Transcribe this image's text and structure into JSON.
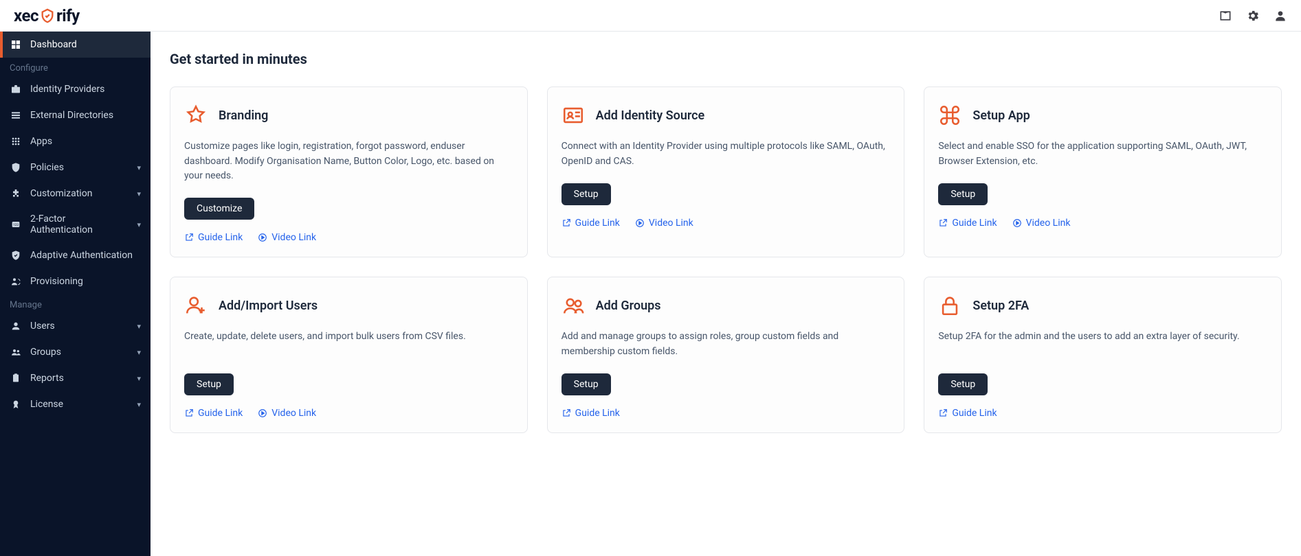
{
  "brand": {
    "name_left": "xec",
    "name_right": "rify"
  },
  "sidebar": {
    "items": [
      {
        "label": "Dashboard"
      },
      {
        "label": "Identity Providers"
      },
      {
        "label": "External Directories"
      },
      {
        "label": "Apps"
      },
      {
        "label": "Policies"
      },
      {
        "label": "Customization"
      },
      {
        "label": "2-Factor Authentication"
      },
      {
        "label": "Adaptive Authentication"
      },
      {
        "label": "Provisioning"
      },
      {
        "label": "Users"
      },
      {
        "label": "Groups"
      },
      {
        "label": "Reports"
      },
      {
        "label": "License"
      }
    ],
    "sections": {
      "configure": "Configure",
      "manage": "Manage"
    }
  },
  "page": {
    "title": "Get started in minutes"
  },
  "cards": [
    {
      "title": "Branding",
      "desc": "Customize pages like login, registration, forgot password, enduser dashboard. Modify Organisation Name, Button Color, Logo, etc. based on your needs.",
      "button": "Customize",
      "guide": "Guide Link",
      "video": "Video Link"
    },
    {
      "title": "Add Identity Source",
      "desc": "Connect with an Identity Provider using multiple protocols like SAML, OAuth, OpenID and CAS.",
      "button": "Setup",
      "guide": "Guide Link",
      "video": "Video Link"
    },
    {
      "title": "Setup App",
      "desc": "Select and enable SSO for the application supporting SAML, OAuth, JWT, Browser Extension, etc.",
      "button": "Setup",
      "guide": "Guide Link",
      "video": "Video Link"
    },
    {
      "title": "Add/Import Users",
      "desc": "Create, update, delete users, and import bulk users from CSV files.",
      "button": "Setup",
      "guide": "Guide Link",
      "video": "Video Link"
    },
    {
      "title": "Add Groups",
      "desc": "Add and manage groups to assign roles, group custom fields and membership custom fields.",
      "button": "Setup",
      "guide": "Guide Link",
      "video": null
    },
    {
      "title": "Setup 2FA",
      "desc": "Setup 2FA for the admin and the users to add an extra layer of security.",
      "button": "Setup",
      "guide": "Guide Link",
      "video": null
    }
  ]
}
